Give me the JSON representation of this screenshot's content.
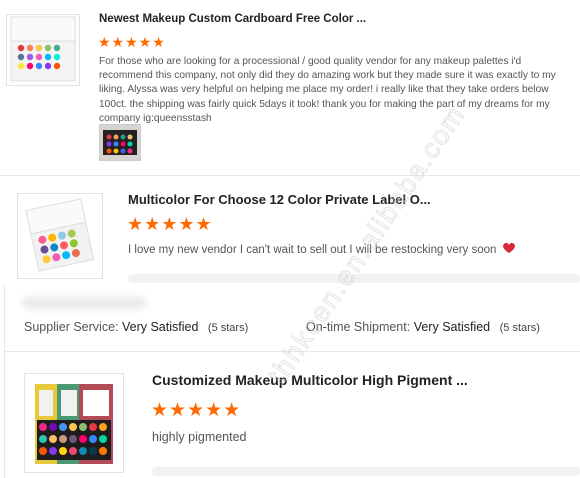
{
  "reviews": [
    {
      "title": "Newest Makeup Custom Cardboard Free Color ...",
      "stars": "★★★★★",
      "text": "For those who are looking for a processional / good quality vendor for any makeup palettes i'd recommend this company, not only did they do amazing work but they made sure it was exactly to my liking. Alyssa was very helpful on helping me place my order! i really like that they take orders below 100ct. the shipping was fairly quick 5days it took! thank you for making the part of my dreams for my company ig:queensstash"
    },
    {
      "title": "Multicolor For Choose 12 Color Private Label O...",
      "stars": "★★★★★",
      "text": "I love my new vendor I can't wait to sell out I will be restocking very soon"
    },
    {
      "title": "Customized Makeup Multicolor High Pigment ...",
      "stars": "★★★★★",
      "text": "highly pigmented"
    }
  ],
  "ratings": {
    "supplier_label": "Supplier Service:",
    "supplier_value": "Very Satisfied",
    "supplier_stars": "(5 stars)",
    "shipment_label": "On-time Shipment:",
    "shipment_value": "Very Satisfied",
    "shipment_stars": "(5 stars)"
  },
  "watermark": "thhkcen.en.alibaba.com",
  "colors": {
    "star": "#ff6a00",
    "heart": "#d62839"
  }
}
